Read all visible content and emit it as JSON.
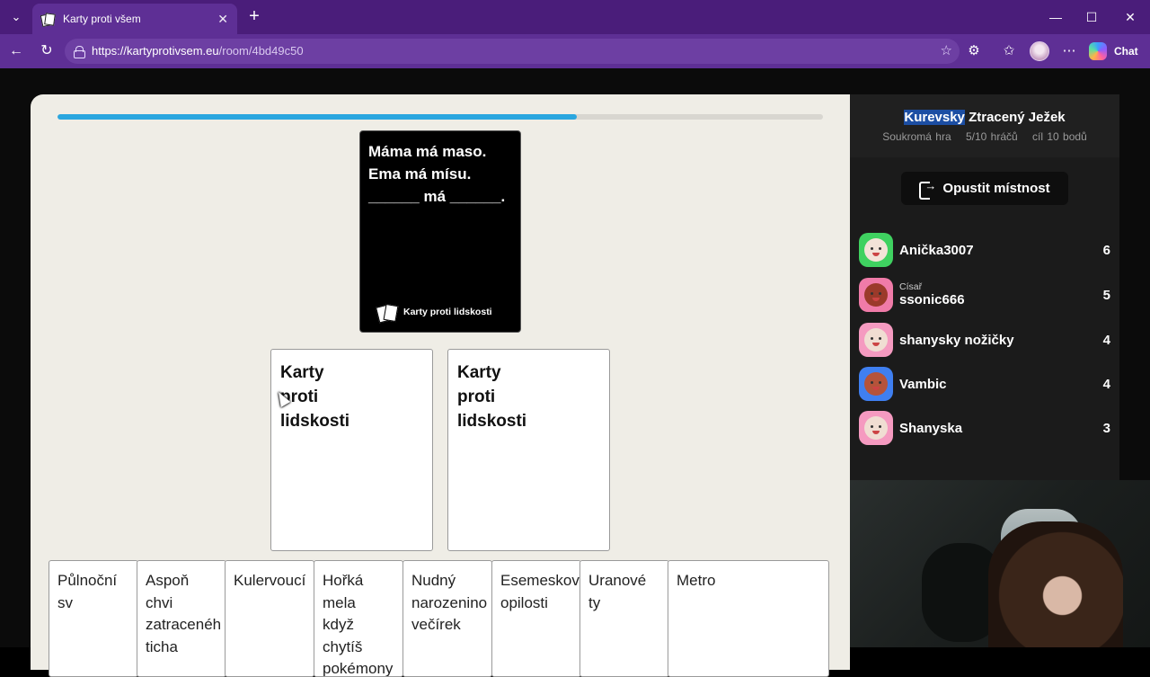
{
  "browser": {
    "tab_title": "Karty proti všem",
    "tab_close": "✕",
    "new_tab": "+",
    "url_host": "https://kartyprotivsem.eu",
    "url_path": "/room/4bd49c50",
    "chat_label": "Chat",
    "window_controls": {
      "minimize": "—",
      "maximize": "☐",
      "close": "✕"
    }
  },
  "game": {
    "progress_percent": 67.8,
    "black_card": {
      "text": "Máma má maso.\nEma má mísu.\n______ má ______.",
      "brand": "Karty proti lidskosti"
    },
    "played_cards": [
      {
        "text": "Karty\nproti\nlidskosti"
      },
      {
        "text": "Karty\nproti\nlidskosti"
      }
    ],
    "hand": [
      {
        "text": "Půlnoční sv"
      },
      {
        "text": "Aspoň chvi\nzatracenéh\nticha"
      },
      {
        "text": "Kulervoucí"
      },
      {
        "text": "Hořká mela\nkdyž chytíš\npokémony"
      },
      {
        "text": "Nudný\nnarozenino\nvečírek"
      },
      {
        "text": "Esemeskov\nopilosti"
      },
      {
        "text": "Uranové ty"
      },
      {
        "text": "Metro"
      }
    ]
  },
  "sidebar": {
    "room_name_highlight": "Kurevsky",
    "room_name_rest": " Ztracený Ježek",
    "room_type": "Soukromá hra",
    "players_count": "5/10 hráčů",
    "goal": "cíl 10 bodů",
    "leave_label": "Opustit místnost",
    "players": [
      {
        "name": "Anička3007",
        "role": "",
        "score": "6",
        "color": "#3fd160",
        "face": "#f3e3d8"
      },
      {
        "name": "ssonic666",
        "role": "Císař",
        "score": "5",
        "color": "#f07ba8",
        "face": "#9b3a2a"
      },
      {
        "name": "shanysky nožičky",
        "role": "",
        "score": "4",
        "color": "#f59ac0",
        "face": "#f0ddd2"
      },
      {
        "name": "Vambic",
        "role": "",
        "score": "4",
        "color": "#3f7ff0",
        "face": "#b5533a"
      },
      {
        "name": "Shanyska",
        "role": "",
        "score": "3",
        "color": "#f59ac0",
        "face": "#f0ddd2"
      }
    ]
  },
  "icons": {
    "tab_list": "chevron-down-icon",
    "back": "arrow-left-icon",
    "reload": "reload-icon",
    "lock": "lock-icon",
    "favorite": "star-icon",
    "extensions": "puzzle-icon",
    "favorites": "favorites-icon",
    "more": "more-icon",
    "leave": "exit-icon"
  }
}
